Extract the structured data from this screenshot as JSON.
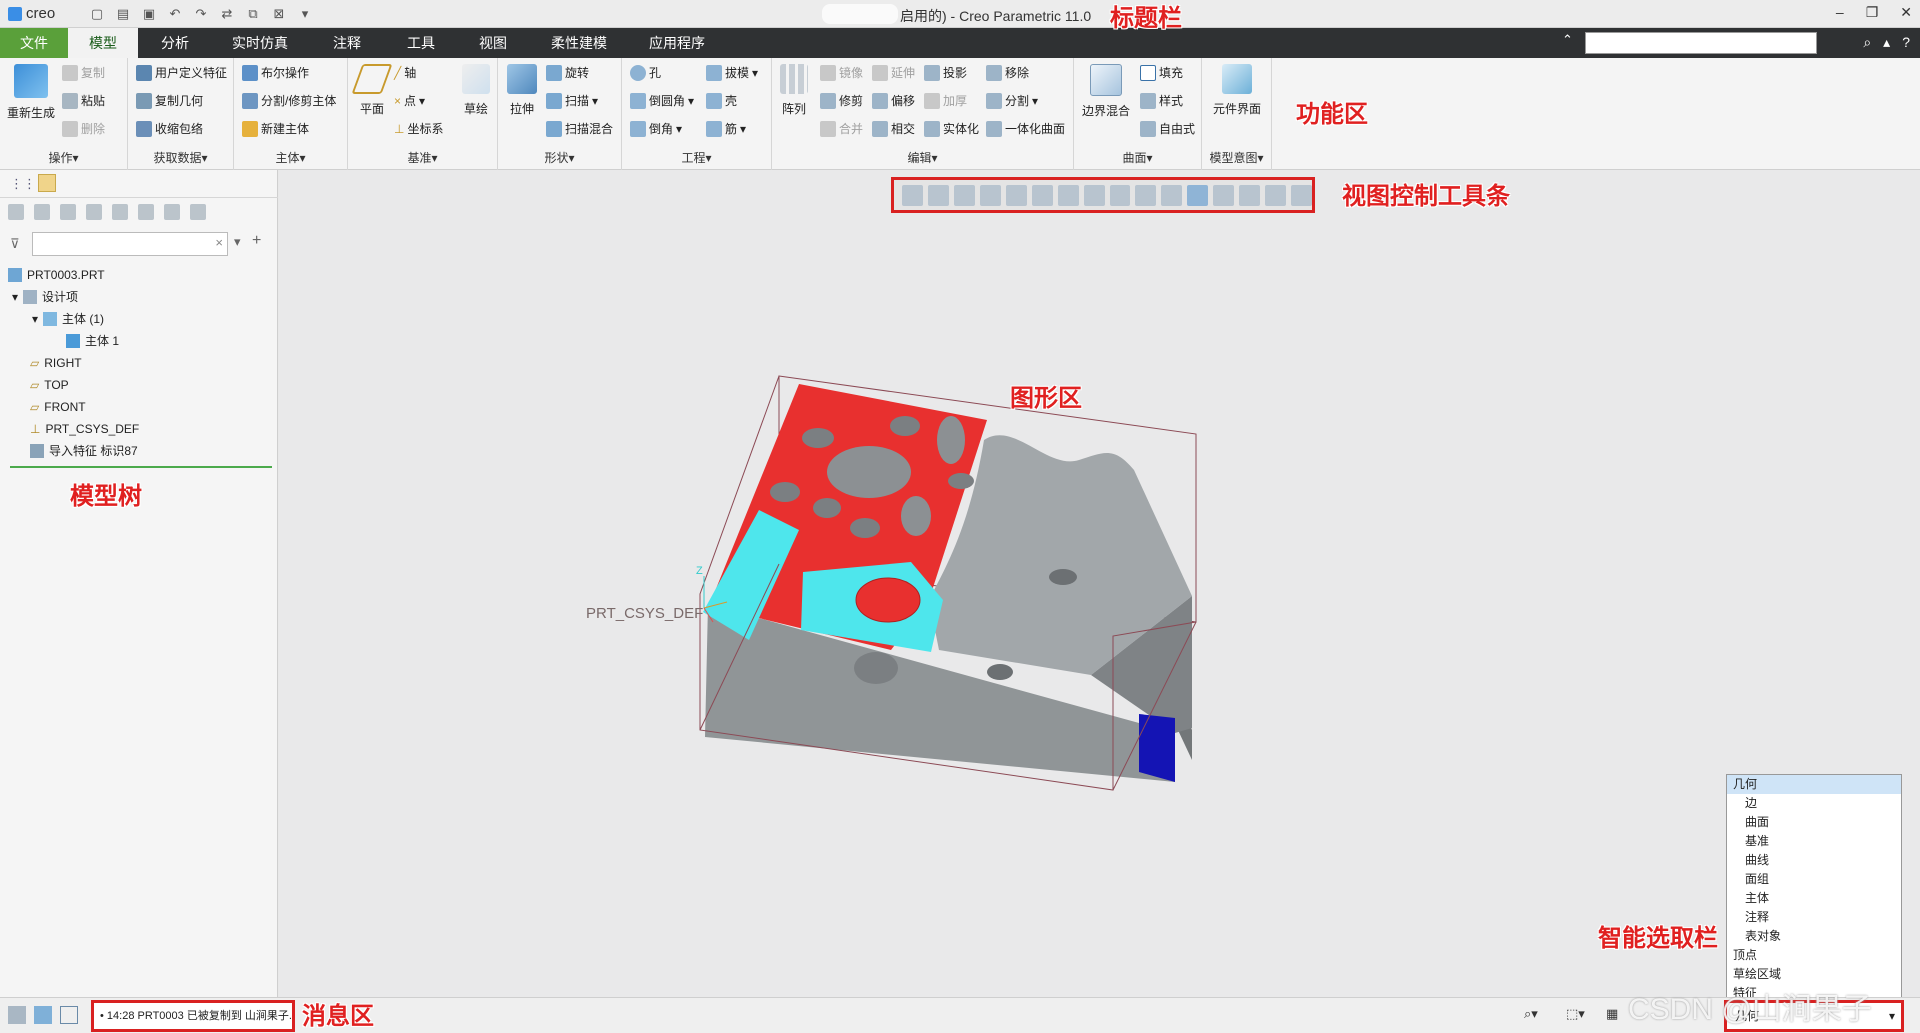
{
  "title": {
    "logo": "creo",
    "text": "启用的) - Creo Parametric 11.0"
  },
  "menu": {
    "tabs": [
      "文件",
      "模型",
      "分析",
      "实时仿真",
      "注释",
      "工具",
      "视图",
      "柔性建模",
      "应用程序"
    ]
  },
  "ribbon": {
    "groups": {
      "ops": "操作▾",
      "getdata": "获取数据▾",
      "body": "主体▾",
      "datum": "基准▾",
      "shape": "形状▾",
      "eng": "工程▾",
      "edit": "编辑▾",
      "surface": "曲面▾",
      "intent": "模型意图▾"
    },
    "buttons": {
      "regen": "重新生成",
      "copy": "复制",
      "paste": "粘贴",
      "delete": "删除",
      "udf": "用户定义特征",
      "copygeom": "复制几何",
      "shrinkwrap": "收缩包络",
      "boolean": "布尔操作",
      "split": "分割/修剪主体",
      "newbody": "新建主体",
      "plane": "平面",
      "axis": "轴",
      "point": "点",
      "csys": "坐标系",
      "sketch": "草绘",
      "extrude": "拉伸",
      "revolve": "旋转",
      "sweep": "扫描",
      "sweepblend": "扫描混合",
      "hole": "孔",
      "round": "倒圆角",
      "chamfer": "倒角",
      "draft": "拔模",
      "shell": "壳",
      "rib": "筋",
      "pattern": "阵列",
      "mirror": "镜像",
      "extend": "延伸",
      "project": "投影",
      "trim": "修剪",
      "offset": "偏移",
      "thicken": "加厚",
      "merge": "合并",
      "intersect": "相交",
      "solidify": "实体化",
      "remove": "移除",
      "divide": "分割",
      "unify": "一体化曲面",
      "boundary": "边界混合",
      "fill": "填充",
      "style": "样式",
      "freestyle": "自由式",
      "component": "元件界面"
    }
  },
  "tree": {
    "items": [
      "PRT0003.PRT",
      "设计项",
      "主体 (1)",
      "主体 1",
      "RIGHT",
      "TOP",
      "FRONT",
      "PRT_CSYS_DEF",
      "导入特征 标识87"
    ]
  },
  "graphics": {
    "csys_label": "PRT_CSYS_DEF"
  },
  "smart_filter": {
    "options": [
      "几何",
      "边",
      "曲面",
      "基准",
      "曲线",
      "面组",
      "主体",
      "注释",
      "表对象",
      "顶点",
      "草绘区域",
      "特征"
    ],
    "selected": "几何"
  },
  "status": {
    "message": "• 14:28 PRT0003 已被复制到 山涧果子."
  },
  "annotations": {
    "titlebar": "标题栏",
    "ribbon": "功能区",
    "viewtoolbar": "视图控制工具条",
    "graphics": "图形区",
    "modeltree": "模型树",
    "smartbar": "智能选取栏",
    "message": "消息区"
  },
  "watermark": "CSDN @山涧果子",
  "colors": {
    "file_tab": "#5aa03a",
    "menubar": "#2f3133",
    "annotation": "#e02020",
    "part_red": "#e8302f",
    "part_cyan": "#4ee6ec",
    "part_gray": "#8f9497",
    "part_blue": "#1414b4"
  }
}
